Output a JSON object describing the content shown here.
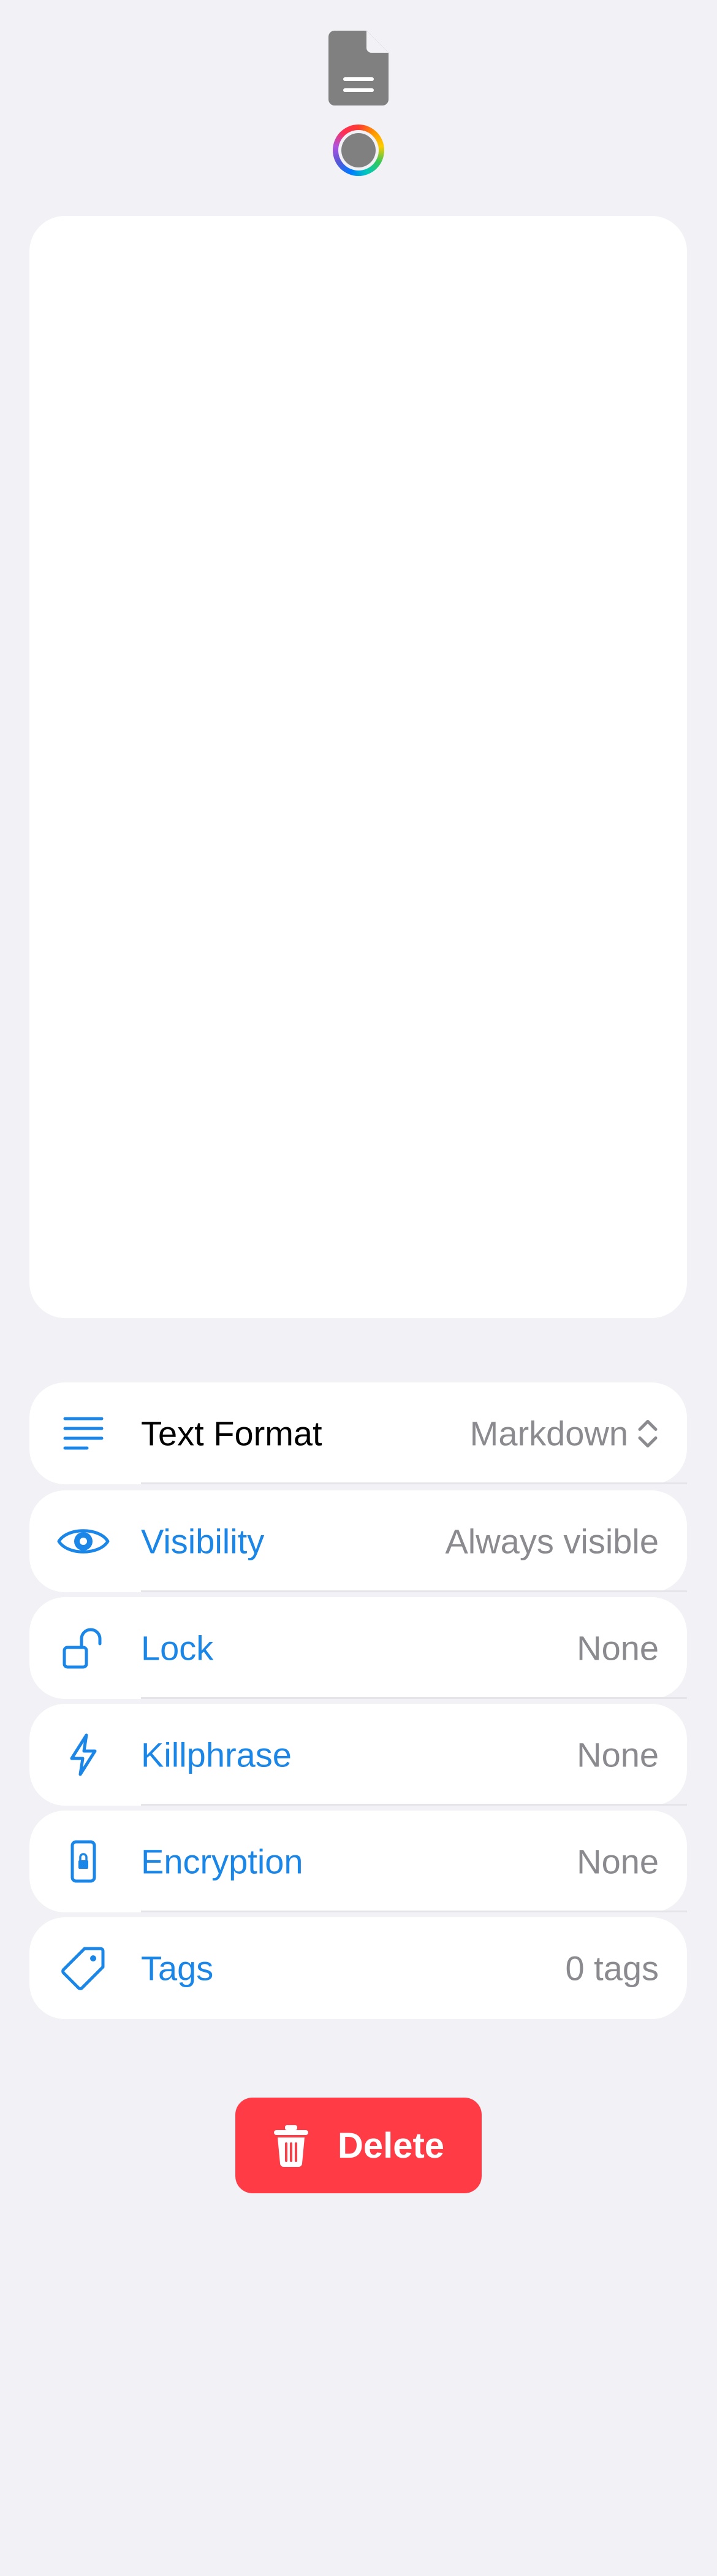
{
  "header": {
    "document_icon": "document-icon",
    "color_picker_icon": "color-ring-icon"
  },
  "editor": {
    "content": ""
  },
  "settings": {
    "text_format": {
      "label": "Text Format",
      "value": "Markdown",
      "icon": "text-lines-icon"
    },
    "visibility": {
      "label": "Visibility",
      "value": "Always visible",
      "icon": "eye-icon"
    },
    "lock": {
      "label": "Lock",
      "value": "None",
      "icon": "unlock-icon"
    },
    "killphrase": {
      "label": "Killphrase",
      "value": "None",
      "icon": "lightning-icon"
    },
    "encryption": {
      "label": "Encryption",
      "value": "None",
      "icon": "encrypted-phone-icon"
    },
    "tags": {
      "label": "Tags",
      "value": "0 tags",
      "icon": "tag-icon"
    }
  },
  "actions": {
    "delete_label": "Delete",
    "delete_icon": "trash-icon"
  },
  "colors": {
    "background": "#f1f1f6",
    "accent": "#1a86e8",
    "delete": "#ff3b45",
    "secondary_text": "#8a8a8f"
  }
}
